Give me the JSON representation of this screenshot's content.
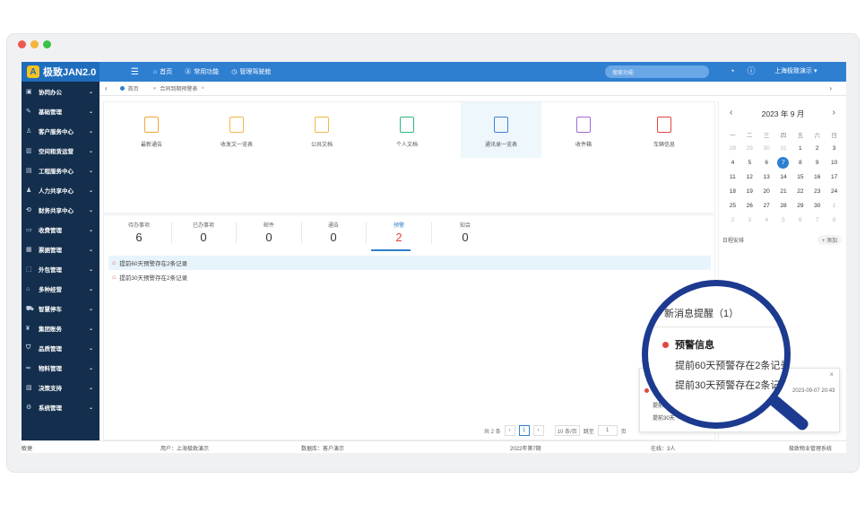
{
  "app": {
    "logo_mark": "A",
    "title": "极致JAN2.0"
  },
  "topbar": {
    "menu_icon": "menu-icon",
    "nav": [
      {
        "icon": "home-icon",
        "label": "首页"
      },
      {
        "icon": "grid-icon",
        "label": "常用功能"
      },
      {
        "icon": "clock-icon",
        "label": "管理驾驶舱"
      }
    ],
    "search_placeholder": "搜索功能",
    "user": "上海极致演示 ▾"
  },
  "sidebar": {
    "items": [
      {
        "icon": "folder-icon",
        "label": "协同办公"
      },
      {
        "icon": "edit-icon",
        "label": "基础管理"
      },
      {
        "icon": "user-icon",
        "label": "客户服务中心"
      },
      {
        "icon": "building-icon",
        "label": "空间租赁运营"
      },
      {
        "icon": "doc-icon",
        "label": "工程服务中心"
      },
      {
        "icon": "people-icon",
        "label": "人力共享中心"
      },
      {
        "icon": "share-icon",
        "label": "财务共享中心"
      },
      {
        "icon": "wallet-icon",
        "label": "收费管理"
      },
      {
        "icon": "ticket-icon",
        "label": "票据管理"
      },
      {
        "icon": "box-icon",
        "label": "外包管理"
      },
      {
        "icon": "shop-icon",
        "label": "多种经营"
      },
      {
        "icon": "car-icon",
        "label": "智慧停车"
      },
      {
        "icon": "money-icon",
        "label": "集团账务"
      },
      {
        "icon": "shield-icon",
        "label": "品质管理"
      },
      {
        "icon": "link-icon",
        "label": "物料管理"
      },
      {
        "icon": "chart-icon",
        "label": "决策支持"
      },
      {
        "icon": "gear-icon",
        "label": "系统管理"
      }
    ]
  },
  "tabs": [
    {
      "label": "首页"
    },
    {
      "label": "合同到期预警表"
    }
  ],
  "quick": [
    {
      "label": "最新通告",
      "color": "#f0a93b"
    },
    {
      "label": "收发文一览表",
      "color": "#f0b84b"
    },
    {
      "label": "公共文档",
      "color": "#f0b84b"
    },
    {
      "label": "个人文档",
      "color": "#2bb87c"
    },
    {
      "label": "通讯录一览表",
      "color": "#3f7fd6"
    },
    {
      "label": "收件箱",
      "color": "#a06ad6"
    },
    {
      "label": "车辆信息",
      "color": "#e3453e"
    }
  ],
  "stats": [
    {
      "label": "待办事项",
      "value": "6"
    },
    {
      "label": "已办事项",
      "value": "0"
    },
    {
      "label": "邮件",
      "value": "0"
    },
    {
      "label": "通告",
      "value": "0"
    },
    {
      "label": "预警",
      "value": "2"
    },
    {
      "label": "知会",
      "value": "0"
    }
  ],
  "list": [
    {
      "text": "提前60天预警存在2条记录"
    },
    {
      "text": "提前30天预警存在2条记录"
    }
  ],
  "pager": {
    "total": "共 2 条",
    "page": "1",
    "per_page": "10 条/页",
    "jump_label": "跳至",
    "jump_value": "1",
    "page_suffix": "页"
  },
  "calendar": {
    "title": "2023 年 9 月",
    "weekdays": [
      "一",
      "二",
      "三",
      "四",
      "五",
      "六",
      "日"
    ],
    "days": [
      {
        "d": "28",
        "m": true
      },
      {
        "d": "29",
        "m": true
      },
      {
        "d": "30",
        "m": true
      },
      {
        "d": "31",
        "m": true
      },
      {
        "d": "1"
      },
      {
        "d": "2"
      },
      {
        "d": "3"
      },
      {
        "d": "4"
      },
      {
        "d": "5"
      },
      {
        "d": "6"
      },
      {
        "d": "7",
        "t": true
      },
      {
        "d": "8"
      },
      {
        "d": "9"
      },
      {
        "d": "10"
      },
      {
        "d": "11"
      },
      {
        "d": "12"
      },
      {
        "d": "13"
      },
      {
        "d": "14"
      },
      {
        "d": "15"
      },
      {
        "d": "16"
      },
      {
        "d": "17"
      },
      {
        "d": "18"
      },
      {
        "d": "19"
      },
      {
        "d": "20"
      },
      {
        "d": "21"
      },
      {
        "d": "22"
      },
      {
        "d": "23"
      },
      {
        "d": "24"
      },
      {
        "d": "25"
      },
      {
        "d": "26"
      },
      {
        "d": "27"
      },
      {
        "d": "28"
      },
      {
        "d": "29"
      },
      {
        "d": "30"
      },
      {
        "d": "1",
        "m": true
      },
      {
        "d": "2",
        "m": true
      },
      {
        "d": "3",
        "m": true
      },
      {
        "d": "4",
        "m": true
      },
      {
        "d": "5",
        "m": true
      },
      {
        "d": "6",
        "m": true
      },
      {
        "d": "7",
        "m": true
      },
      {
        "d": "8",
        "m": true
      }
    ],
    "schedule_label": "日程安排",
    "add_label": "+ 添加"
  },
  "status_bar": {
    "left": "敏捷",
    "user": "用户：上海极致演示",
    "db": "数据库：客户演示",
    "period": "2022年第7期",
    "online": "在线：3人",
    "system": "极致物业管理系统"
  },
  "notification": {
    "title": "新消息提醒（1）",
    "heading": "预警信息",
    "lines": [
      "提前60天预警存在2条记录",
      "提前30天预警存在2条记录"
    ],
    "small_lines": [
      "提前",
      "提前30天"
    ],
    "time": "2023-09-07 20:43",
    "close": "×"
  },
  "colors": {
    "primary": "#2f7fd1",
    "sidebar": "#142f4d",
    "alert": "#e3453e",
    "lens": "#1c3a8f"
  }
}
